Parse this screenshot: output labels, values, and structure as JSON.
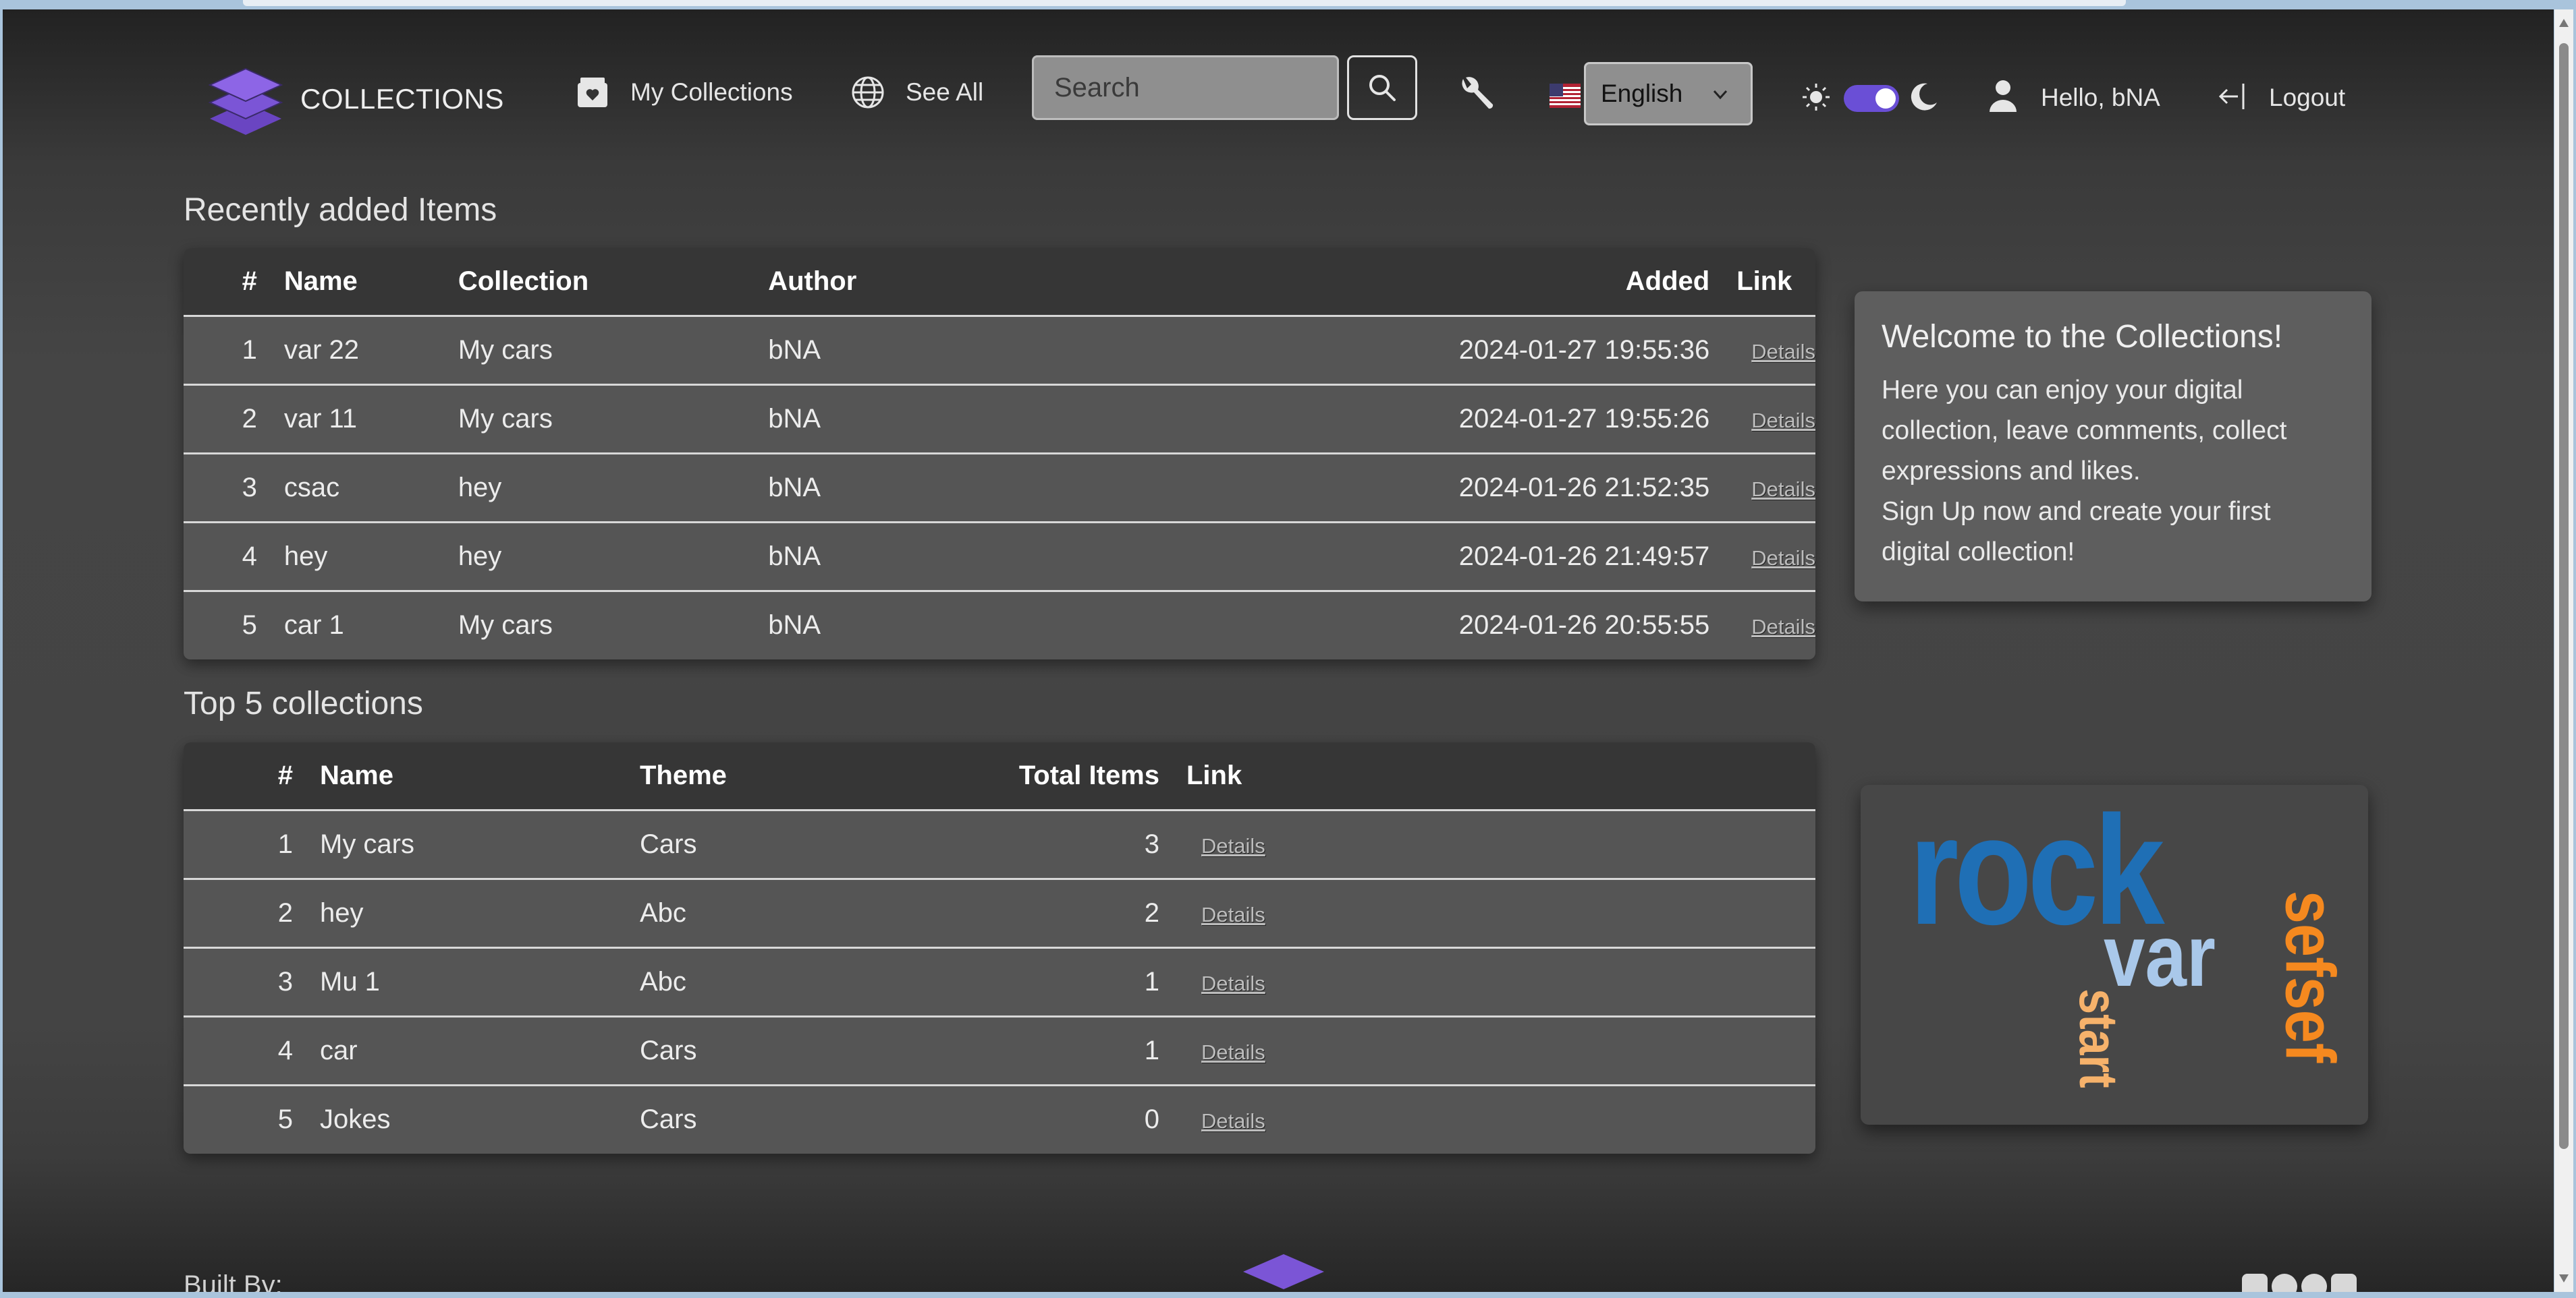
{
  "brand": {
    "name": "COLLECTIONS"
  },
  "nav": {
    "my_collections": "My Collections",
    "see_all": "See All",
    "search_placeholder": "Search",
    "language": "English",
    "greeting": "Hello, bNA",
    "logout": "Logout"
  },
  "recent": {
    "title": "Recently added Items",
    "headers": {
      "num": "#",
      "name": "Name",
      "collection": "Collection",
      "author": "Author",
      "added": "Added",
      "link": "Link"
    },
    "rows": [
      {
        "num": "1",
        "name": "var 22",
        "collection": "My cars",
        "author": "bNA",
        "added": "2024-01-27 19:55:36",
        "link": "Details"
      },
      {
        "num": "2",
        "name": "var 11",
        "collection": "My cars",
        "author": "bNA",
        "added": "2024-01-27 19:55:26",
        "link": "Details"
      },
      {
        "num": "3",
        "name": "csac",
        "collection": "hey",
        "author": "bNA",
        "added": "2024-01-26 21:52:35",
        "link": "Details"
      },
      {
        "num": "4",
        "name": "hey",
        "collection": "hey",
        "author": "bNA",
        "added": "2024-01-26 21:49:57",
        "link": "Details"
      },
      {
        "num": "5",
        "name": "car 1",
        "collection": "My cars",
        "author": "bNA",
        "added": "2024-01-26 20:55:55",
        "link": "Details"
      }
    ]
  },
  "top": {
    "title": "Top 5 collections",
    "headers": {
      "num": "#",
      "name": "Name",
      "theme": "Theme",
      "total": "Total Items",
      "link": "Link"
    },
    "rows": [
      {
        "num": "1",
        "name": "My cars",
        "theme": "Cars",
        "total": "3",
        "link": "Details"
      },
      {
        "num": "2",
        "name": "hey",
        "theme": "Abc",
        "total": "2",
        "link": "Details"
      },
      {
        "num": "3",
        "name": "Mu 1",
        "theme": "Abc",
        "total": "1",
        "link": "Details"
      },
      {
        "num": "4",
        "name": "car",
        "theme": "Cars",
        "total": "1",
        "link": "Details"
      },
      {
        "num": "5",
        "name": "Jokes",
        "theme": "Cars",
        "total": "0",
        "link": "Details"
      }
    ]
  },
  "welcome": {
    "title": "Welcome to the Collections!",
    "line1": "Here you can enjoy your digital collection, leave comments, collect expressions and likes.",
    "line2": "Sign Up now and create your first digital collection!"
  },
  "tag_cloud": {
    "words": [
      {
        "text": "rock",
        "color": "#1f6fb5"
      },
      {
        "text": "var",
        "color": "#a9c8ea"
      },
      {
        "text": "start",
        "color": "#f6b26b"
      },
      {
        "text": "sefsef",
        "color": "#f5891f"
      }
    ]
  },
  "footer": {
    "built_by": "Built By:"
  },
  "colors": {
    "accent": "#6a4fd6",
    "logo_purple": "#7b55d6"
  }
}
